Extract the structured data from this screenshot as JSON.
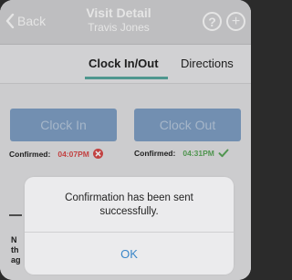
{
  "navbar": {
    "back_label": "Back",
    "title": "Visit Detail",
    "subtitle": "Travis Jones",
    "help_glyph": "?",
    "add_glyph": "+",
    "help_icon": "question-circle-icon",
    "add_icon": "plus-circle-icon"
  },
  "tabs": [
    {
      "label": "Clock In/Out",
      "active": true
    },
    {
      "label": "Directions",
      "active": false
    }
  ],
  "clock_in": {
    "button_label": "Clock In",
    "confirmed_label": "Confirmed:",
    "time": "04:07PM",
    "status": "error",
    "status_icon": "x-circle-icon"
  },
  "clock_out": {
    "button_label": "Clock Out",
    "confirmed_label": "Confirmed:",
    "time": "04:31PM",
    "status": "success",
    "status_icon": "checkmark-icon"
  },
  "note_fragment": [
    "N",
    "th",
    "ag"
  ],
  "dialog": {
    "message": "Confirmation has been sent successfully.",
    "ok_label": "OK"
  },
  "colors": {
    "accent_tab": "#59a9a0",
    "button_bg": "#7fa0c6",
    "error": "#d94a4a",
    "success": "#5aa65a",
    "dialog_action": "#3a86c8"
  }
}
